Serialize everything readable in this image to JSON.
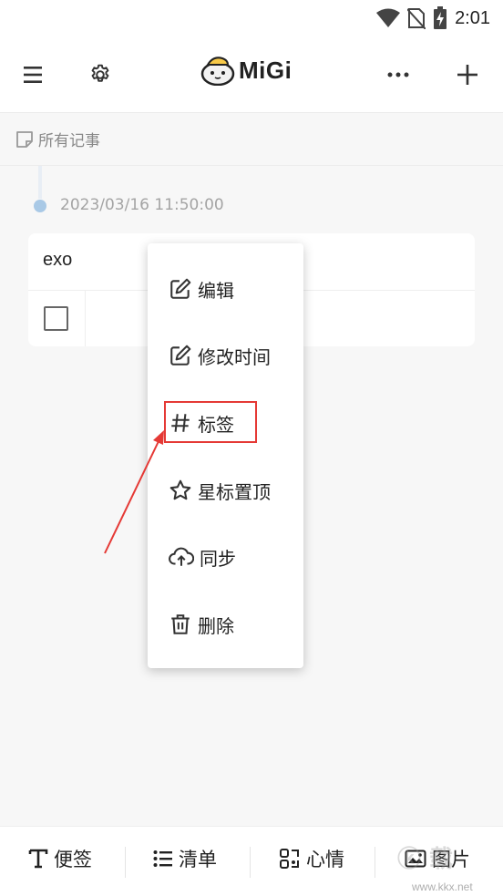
{
  "status_bar": {
    "time": "2:01"
  },
  "top_bar": {
    "app_name": "MiGi"
  },
  "breadcrumb": {
    "label": "所有记事"
  },
  "note": {
    "timestamp": "2023/03/16 11:50:00",
    "title": "exo"
  },
  "context_menu": {
    "items": [
      {
        "label": "编辑",
        "icon": "edit-icon"
      },
      {
        "label": "修改时间",
        "icon": "edit-time-icon"
      },
      {
        "label": "标签",
        "icon": "hash-icon"
      },
      {
        "label": "星标置顶",
        "icon": "star-icon"
      },
      {
        "label": "同步",
        "icon": "cloud-upload-icon"
      },
      {
        "label": "删除",
        "icon": "trash-icon"
      }
    ]
  },
  "bottom_bar": {
    "items": [
      {
        "label": "便签",
        "icon": "text-icon"
      },
      {
        "label": "清单",
        "icon": "list-icon"
      },
      {
        "label": "心情",
        "icon": "mood-icon"
      },
      {
        "label": "图片",
        "icon": "image-icon"
      }
    ]
  },
  "watermark": {
    "text": "ⓚ 载",
    "url": "www.kkx.net"
  },
  "colors": {
    "highlight": "#e53935",
    "arrow": "#e53935",
    "timeline_dot": "#a9c9e6",
    "background": "#f7f7f7"
  }
}
